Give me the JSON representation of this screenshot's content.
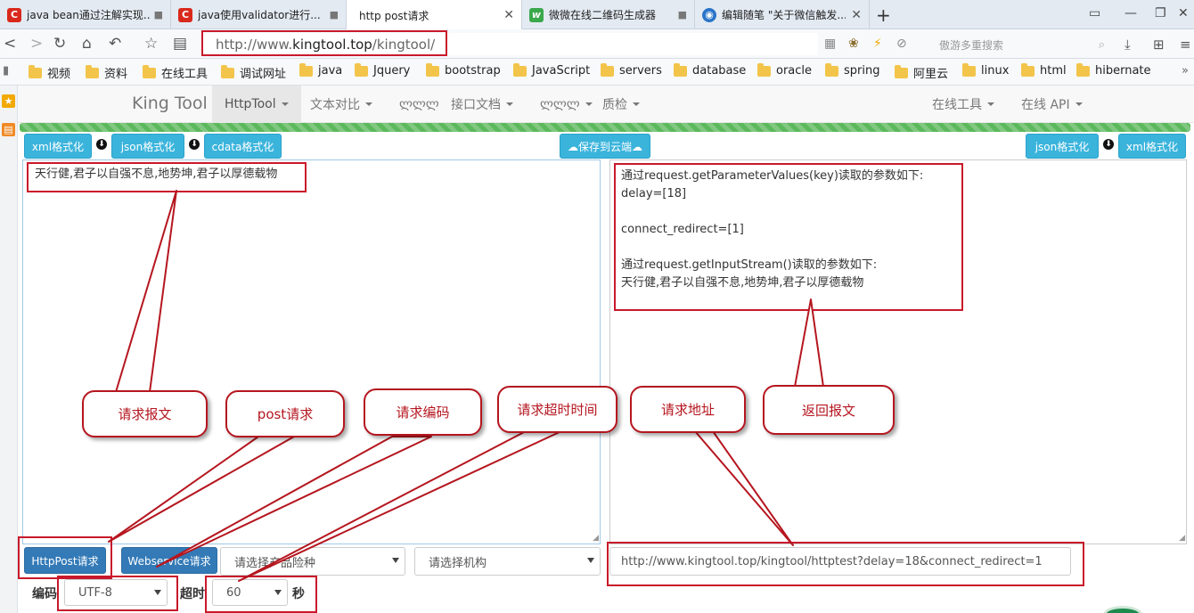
{
  "browser": {
    "tabs": [
      {
        "title": "java bean通过注解实现...",
        "favicon": "C",
        "locked": true
      },
      {
        "title": "java使用validator进行...",
        "favicon": "C",
        "locked": true
      },
      {
        "title": "http post请求",
        "favicon": "",
        "active": true
      },
      {
        "title": "微微在线二维码生成器",
        "favicon": "w",
        "locked": true
      },
      {
        "title": "编辑随笔 \"关于微信触发...",
        "favicon": "o"
      }
    ],
    "address": {
      "prefix": "http://www.",
      "host": "kingtool.top",
      "suffix": "/kingtool/"
    },
    "search_placeholder": "傲游多重搜索",
    "bookmarks": [
      "视频",
      "资料",
      "在线工具",
      "调试网址",
      "java",
      "Jquery",
      "bootstrap",
      "JavaScript",
      "servers",
      "database",
      "oracle",
      "spring",
      "阿里云",
      "linux",
      "html",
      "hibernate"
    ]
  },
  "site": {
    "brand": "King Tool",
    "menu": [
      "HttpTool",
      "文本对比",
      "ლლლ",
      "接口文档",
      "ლლლ",
      "质检"
    ],
    "menu_right": [
      "在线工具",
      "在线 API"
    ]
  },
  "toolbar": {
    "left": [
      "xml格式化",
      "json格式化",
      "cdata格式化"
    ],
    "center": "☁保存到云端☁",
    "right": [
      "json格式化",
      "xml格式化"
    ]
  },
  "panes": {
    "request": "天行健,君子以自强不息,地势坤,君子以厚德载物",
    "response": "通过request.getParameterValues(key)读取的参数如下:\ndelay=[18]\n\nconnect_redirect=[1]\n\n通过request.getInputStream()读取的参数如下:\n天行健,君子以自强不息,地势坤,君子以厚德载物"
  },
  "actions": {
    "httppost": "HttpPost请求",
    "webservice": "Webservice请求",
    "product_select": "请选择产品险种",
    "org_select": "请选择机构",
    "url": "http://www.kingtool.top/kingtool/httptest?delay=18&connect_redirect=1",
    "encoding_label": "编码",
    "encoding": "UTF-8",
    "timeout_label": "超时",
    "timeout": "60",
    "timeout_unit": "秒"
  },
  "callouts": {
    "request_body": "请求报文",
    "post": "post请求",
    "encoding": "请求编码",
    "timeout": "请求超时时间",
    "url": "请求地址",
    "response": "返回报文"
  },
  "colors": {
    "accent": "#3bb4dc",
    "primary": "#337ab7",
    "progress": "#5cb85c",
    "annotation": "#c9192b"
  }
}
